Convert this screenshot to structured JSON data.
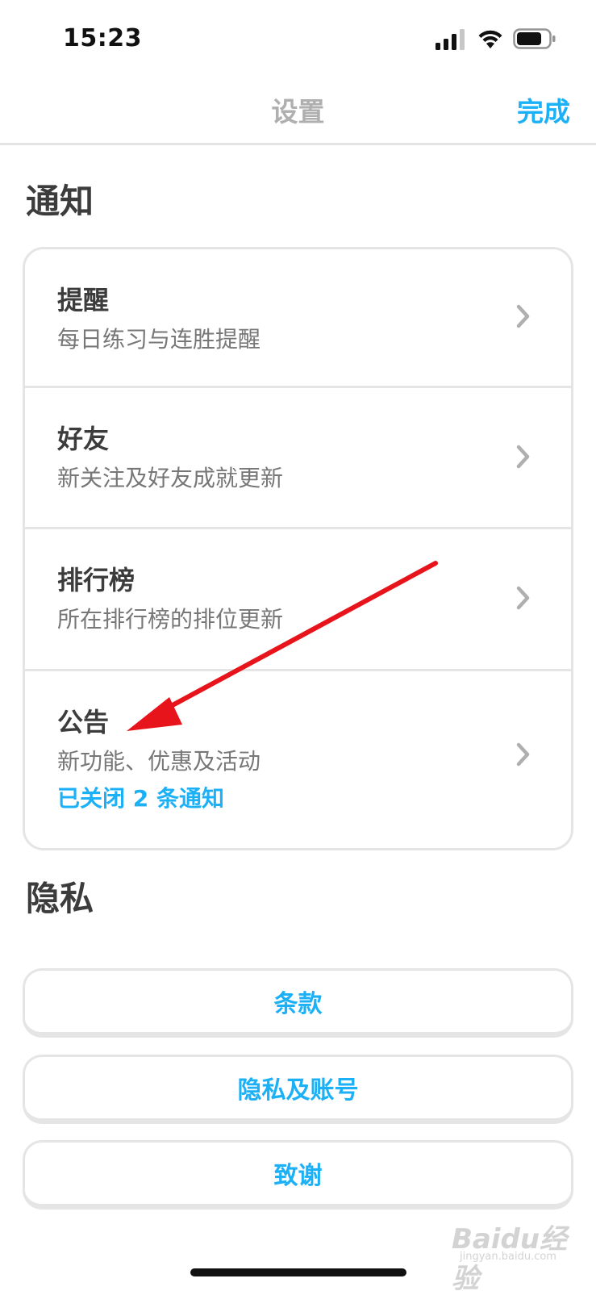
{
  "status": {
    "time": "15:23",
    "icons": [
      "cellular-signal-icon",
      "wifi-icon",
      "battery-icon"
    ]
  },
  "nav": {
    "title": "设置",
    "done_label": "完成"
  },
  "sections": {
    "notifications": {
      "title": "通知",
      "items": [
        {
          "title": "提醒",
          "subtitle": "每日练习与连胜提醒"
        },
        {
          "title": "好友",
          "subtitle": "新关注及好友成就更新"
        },
        {
          "title": "排行榜",
          "subtitle": "所在排行榜的排位更新"
        },
        {
          "title": "公告",
          "subtitle": "新功能、优惠及活动",
          "extra": "已关闭 2 条通知"
        }
      ]
    },
    "privacy": {
      "title": "隐私",
      "buttons": [
        "条款",
        "隐私及账号",
        "致谢"
      ]
    }
  },
  "watermark": {
    "logo": "Baidu经验",
    "site": "jingyan.baidu.com"
  },
  "colors": {
    "accent": "#1cb0f6",
    "title_gray": "#afafaf",
    "text_dark": "#3c3c3c",
    "text_sub": "#777777",
    "border": "#e5e5e5",
    "annotation_arrow": "#e8141b"
  }
}
